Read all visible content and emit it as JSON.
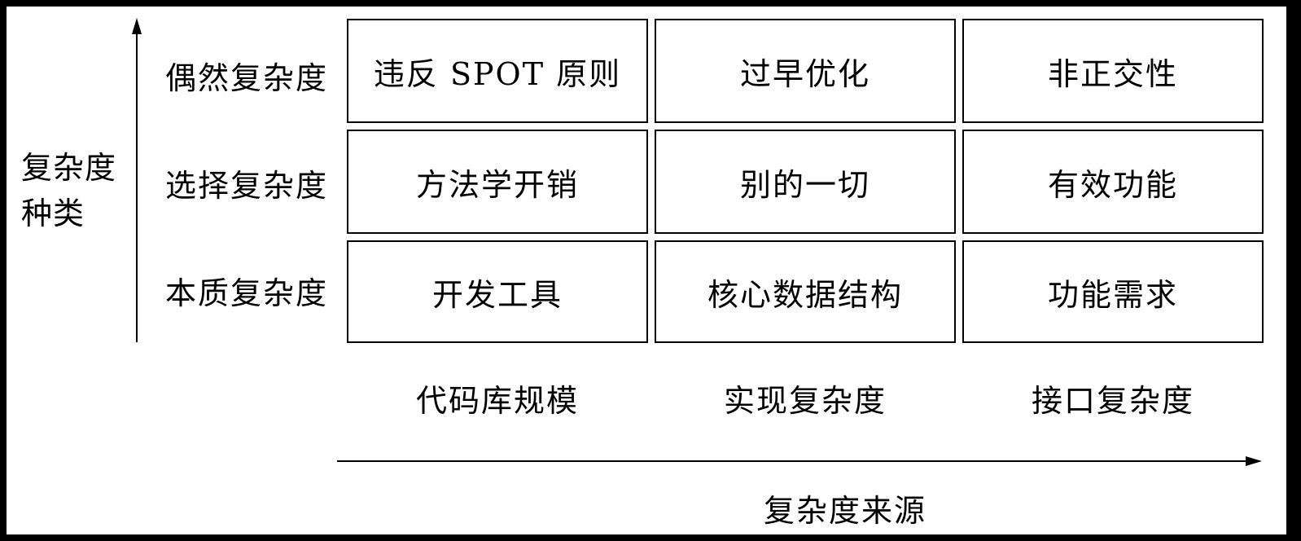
{
  "y_axis": {
    "title_line1": "复杂度",
    "title_line2": "种类"
  },
  "x_axis": {
    "title": "复杂度来源"
  },
  "rows": [
    {
      "label": "偶然复杂度",
      "cells": [
        "违反 SPOT 原则",
        "过早优化",
        "非正交性"
      ]
    },
    {
      "label": "选择复杂度",
      "cells": [
        "方法学开销",
        "别的一切",
        "有效功能"
      ]
    },
    {
      "label": "本质复杂度",
      "cells": [
        "开发工具",
        "核心数据结构",
        "功能需求"
      ]
    }
  ],
  "columns": [
    "代码库规模",
    "实现复杂度",
    "接口复杂度"
  ]
}
